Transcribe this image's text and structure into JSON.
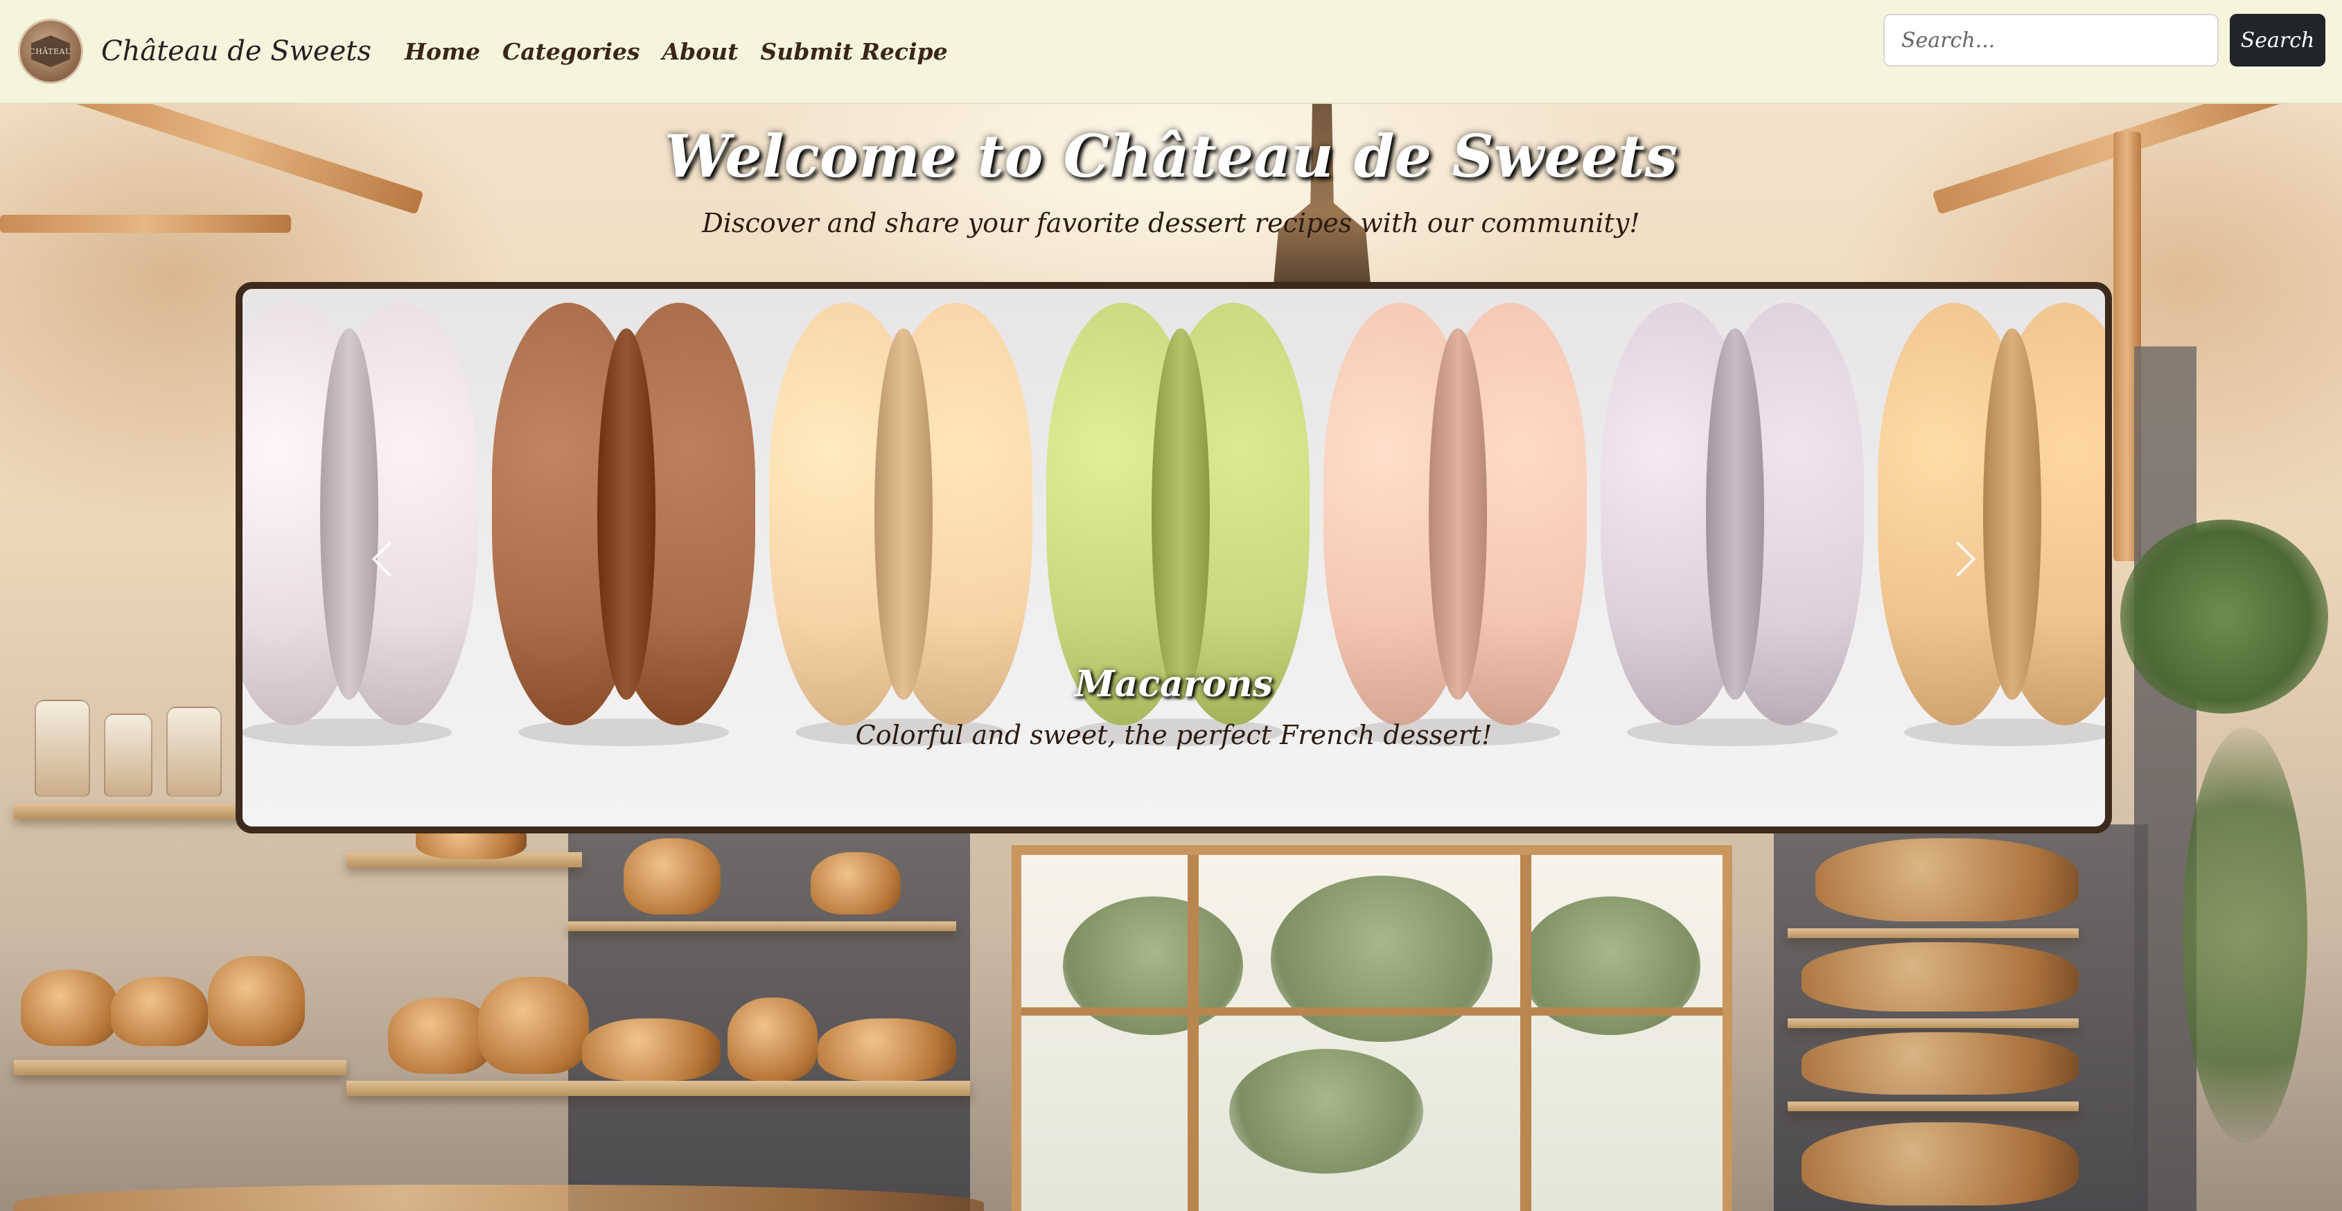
{
  "navbar": {
    "brand_name": "Château de Sweets",
    "logo_text": "CHÂTEAU",
    "links": [
      {
        "label": "Home"
      },
      {
        "label": "Categories"
      },
      {
        "label": "About"
      },
      {
        "label": "Submit Recipe"
      }
    ],
    "search": {
      "placeholder": "Search...",
      "value": "",
      "button_label": "Search"
    }
  },
  "hero": {
    "title": "Welcome to Château de Sweets",
    "subtitle": "Discover and share your favorite dessert recipes with our community!"
  },
  "carousel": {
    "active_slide": {
      "title": "Macarons",
      "caption": "Colorful and sweet, the perfect French dessert!"
    },
    "prev_icon": "chevron-left-icon",
    "next_icon": "chevron-right-icon",
    "macaron_colors": [
      "#e9dde2",
      "#a96c48",
      "#f7d3a6",
      "#c7d77e",
      "#f4c6b2",
      "#ddd0d8",
      "#efc38e"
    ]
  },
  "colors": {
    "navbar_bg": "#f5f4dc",
    "search_button_bg": "#212529",
    "carousel_border": "#3c2a1c",
    "nav_link": "#3a2618"
  }
}
